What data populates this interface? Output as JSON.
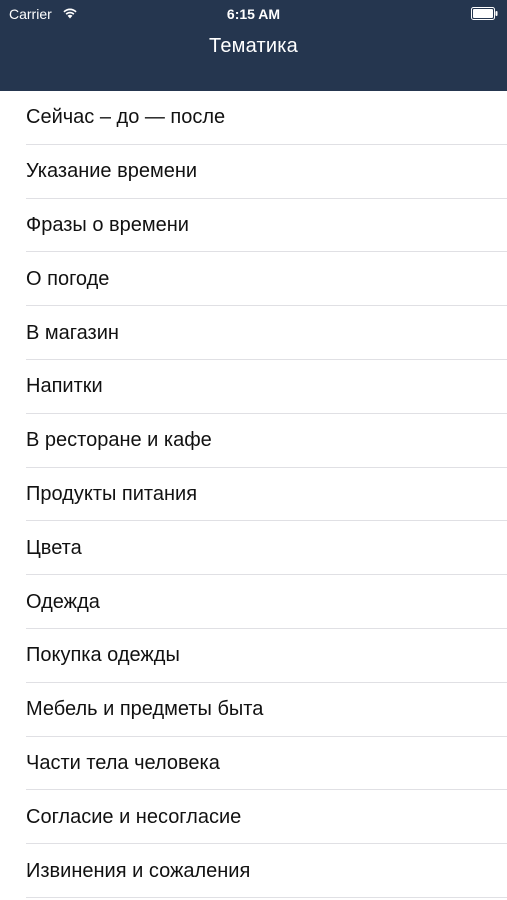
{
  "status_bar": {
    "carrier": "Carrier",
    "time": "6:15 AM"
  },
  "navigation": {
    "title": "Тематика"
  },
  "colors": {
    "header_background": "#25364f",
    "list_background": "#ffffff",
    "separator": "#e0e0e4"
  },
  "topics": [
    "Сейчас – до — после",
    "Указание времени",
    "Фразы о времени",
    "О погоде",
    "В магазин",
    "Напитки",
    "В ресторане и кафе",
    "Продукты питания",
    "Цвета",
    "Одежда",
    "Покупка одежды",
    "Мебель и предметы быта",
    "Части тела человека",
    "Согласие и несогласие",
    "Извинения и сожаления"
  ]
}
